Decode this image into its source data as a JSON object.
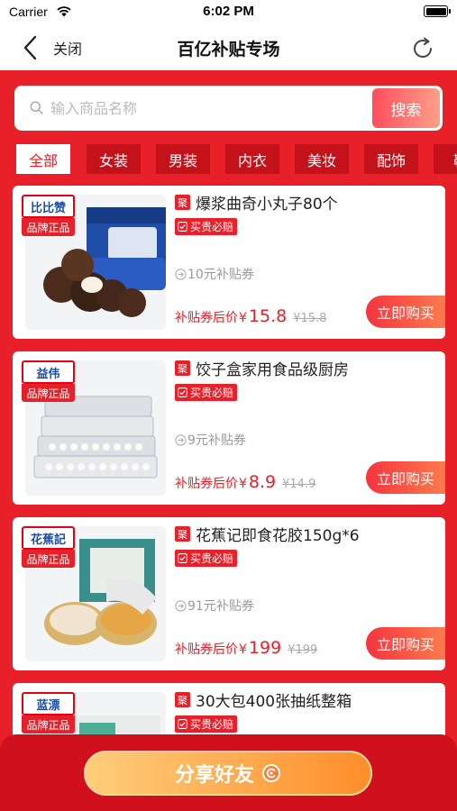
{
  "status": {
    "carrier": "Carrier",
    "time": "6:02 PM",
    "battery_level": 1.0
  },
  "nav": {
    "back_label": "关闭",
    "title": "百亿补贴专场"
  },
  "search": {
    "placeholder": "输入商品名称",
    "value": "",
    "button": "搜索"
  },
  "categories": [
    "全部",
    "女装",
    "男装",
    "内衣",
    "美妆",
    "配饰",
    "鞋"
  ],
  "active_category": "全部",
  "products": [
    {
      "brand": "比比赞",
      "brand_badge": "品牌正品",
      "tag": "聚",
      "title": "爆浆曲奇小丸子80个",
      "guarantee": "买贵必赔",
      "coupon": "10元补贴券",
      "price_label": "补贴券后价",
      "currency": "¥",
      "price": "15.8",
      "original": "¥15.8",
      "buy": "立即购买"
    },
    {
      "brand": "益伟",
      "brand_badge": "品牌正品",
      "tag": "聚",
      "title": "饺子盒家用食品级厨房",
      "guarantee": "买贵必赔",
      "coupon": "9元补贴券",
      "price_label": "补贴券后价",
      "currency": "¥",
      "price": "8.9",
      "original": "¥14.9",
      "buy": "立即购买"
    },
    {
      "brand": "花蕉記",
      "brand_badge": "品牌正品",
      "tag": "聚",
      "title": "花蕉记即食花胶150g*6",
      "guarantee": "买贵必赔",
      "coupon": "91元补贴券",
      "price_label": "补贴券后价",
      "currency": "¥",
      "price": "199",
      "original": "¥199",
      "buy": "立即购买"
    },
    {
      "brand": "蓝漂",
      "brand_badge": "品牌正品",
      "tag": "聚",
      "title": "30大包400张抽纸整箱",
      "guarantee": "买贵必赔"
    }
  ],
  "share": {
    "label": "分享好友"
  },
  "colors": {
    "accent": "#e8202a",
    "dark_red": "#c4121a",
    "orange": "#ff8d2a"
  }
}
